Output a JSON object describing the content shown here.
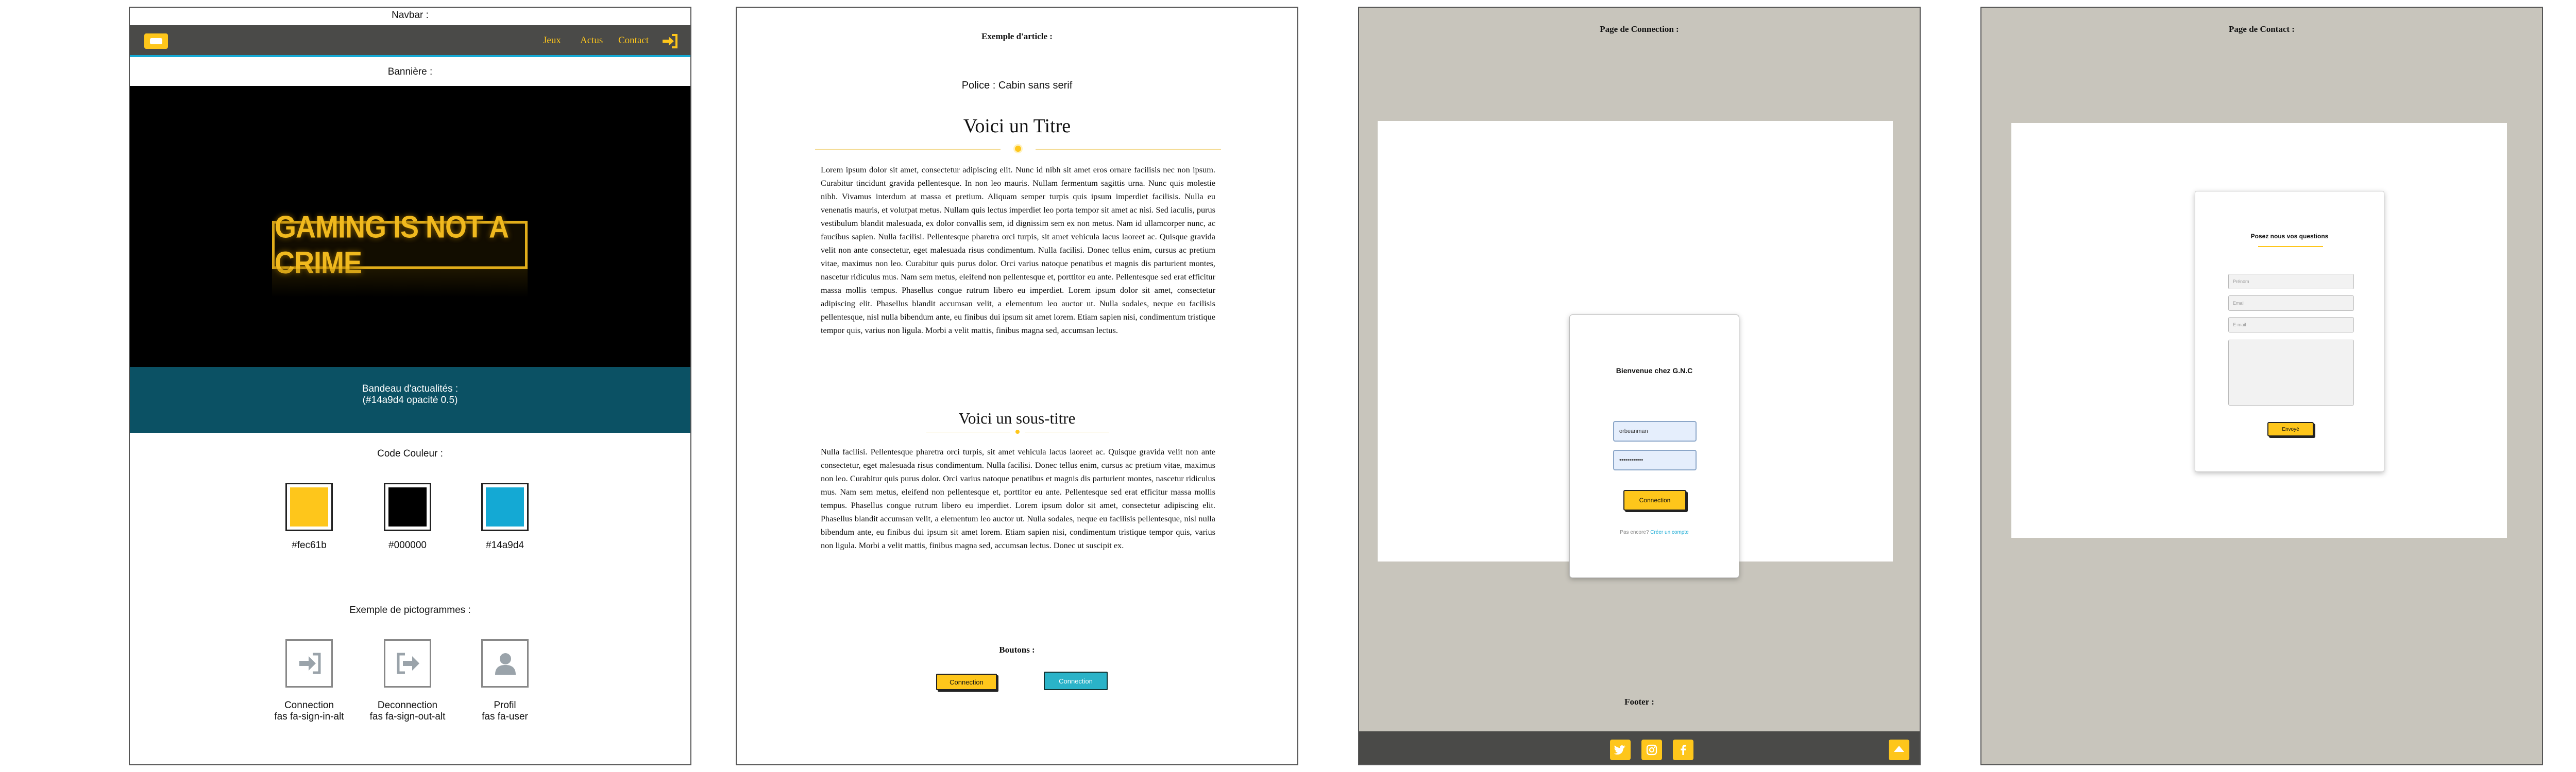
{
  "colors": {
    "yellow": "#fec61b",
    "black": "#000000",
    "blue": "#14a9d4",
    "panel_gray": "#c8c5bc",
    "dark_gray": "#4a4a48"
  },
  "board1": {
    "navbar_label": "Navbar :",
    "nav": {
      "logo_icon": "gamepad-logo-icon",
      "links": [
        "Jeux",
        "Actus",
        "Contact"
      ],
      "signin_icon": "sign-in-icon"
    },
    "banner_label": "Bannière :",
    "banner_text": "GAMING IS NOT A CRIME",
    "ticker_text": "Bandeau d'actualités :",
    "ticker_sub": "(#14a9d4 opacité 0.5)",
    "color_label": "Code Couleur :",
    "swatches": [
      "#fec61b",
      "#000000",
      "#14a9d4"
    ],
    "picto_label": "Exemple de pictogrammes :",
    "pictos": [
      {
        "name": "Connection",
        "code": "fas fa-sign-in-alt",
        "icon": "sign-in-icon"
      },
      {
        "name": "Deconnection",
        "code": "fas fa-sign-out-alt",
        "icon": "sign-out-icon"
      },
      {
        "name": "Profil",
        "code": "fas fa-user",
        "icon": "user-icon"
      }
    ]
  },
  "board2": {
    "heading": "Exemple d'article :",
    "font_note": "Police : Cabin sans serif",
    "title": "Voici un Titre",
    "paragraph1": "Lorem ipsum dolor sit amet, consectetur adipiscing elit. Nunc id nibh sit amet eros ornare facilisis nec non ipsum. Curabitur tincidunt gravida pellentesque. In non leo mauris. Nullam fermentum sagittis urna. Nunc quis molestie nibh. Vivamus interdum at massa et pretium. Aliquam semper turpis quis ipsum imperdiet facilisis. Nulla eu venenatis mauris, et volutpat metus. Nullam quis lectus imperdiet leo porta tempor sit amet ac nisi. Sed iaculis, purus vestibulum blandit malesuada, ex dolor convallis sem, id dignissim sem ex non metus. Nam id ullamcorper nunc, ac faucibus sapien. Nulla facilisi. Pellentesque pharetra orci turpis, sit amet vehicula lacus laoreet ac. Quisque gravida velit non ante consectetur, eget malesuada risus condimentum. Nulla facilisi. Donec tellus enim, cursus ac pretium vitae, maximus non leo. Curabitur quis purus dolor. Orci varius natoque penatibus et magnis dis parturient montes, nascetur ridiculus mus. Nam sem metus, eleifend non pellentesque et, porttitor eu ante. Pellentesque sed erat efficitur massa mollis tempus. Phasellus congue rutrum libero eu imperdiet. Lorem ipsum dolor sit amet, consectetur adipiscing elit. Phasellus blandit accumsan velit, a elementum leo auctor ut. Nulla sodales, neque eu facilisis pellentesque, nisl nulla bibendum ante, eu finibus dui ipsum sit amet lorem. Etiam sapien nisi, condimentum tristique tempor quis, varius non ligula. Morbi a velit mattis, finibus magna sed, accumsan lectus.",
    "subtitle": "Voici un sous-titre",
    "paragraph2": "Nulla facilisi. Pellentesque pharetra orci turpis, sit amet vehicula lacus laoreet ac. Quisque gravida velit non ante consectetur, eget malesuada risus condimentum. Nulla facilisi. Donec tellus enim, cursus ac pretium vitae, maximus non leo. Curabitur quis purus dolor. Orci varius natoque penatibus et magnis dis parturient montes, nascetur ridiculus mus. Nam sem metus, eleifend non pellentesque et, porttitor eu ante. Pellentesque sed erat efficitur massa mollis tempus. Phasellus congue rutrum libero eu imperdiet. Lorem ipsum dolor sit amet, consectetur adipiscing elit. Phasellus blandit accumsan velit, a elementum leo auctor ut. Nulla sodales, neque eu facilisis pellentesque, nisl nulla bibendum ante, eu finibus dui ipsum sit amet lorem. Etiam sapien nisi, condimentum tristique tempor quis, varius non ligula. Morbi a velit mattis, finibus magna sed, accumsan lectus. Donec ut suscipit ex.",
    "buttons_label": "Boutons :",
    "button_yellow": "Connection",
    "button_teal": "Connection"
  },
  "board3": {
    "heading": "Page de Connection :",
    "card_title": "Bienvenue chez G.N.C",
    "username_value": "orbeanman",
    "password_value": "••••••••••••",
    "button": "Connection",
    "no_account": "Pas encore?",
    "create_account": "Créer un compte",
    "footer_label": "Footer :",
    "footer_icons": [
      "twitter-icon",
      "instagram-icon",
      "facebook-icon"
    ],
    "top_button_icon": "arrow-up-icon"
  },
  "board4": {
    "heading": "Page de Contact :",
    "card_title": "Posez nous vos questions",
    "placeholders": [
      "Prénom",
      "Email",
      "E-mail"
    ],
    "button": "Envoyé"
  }
}
